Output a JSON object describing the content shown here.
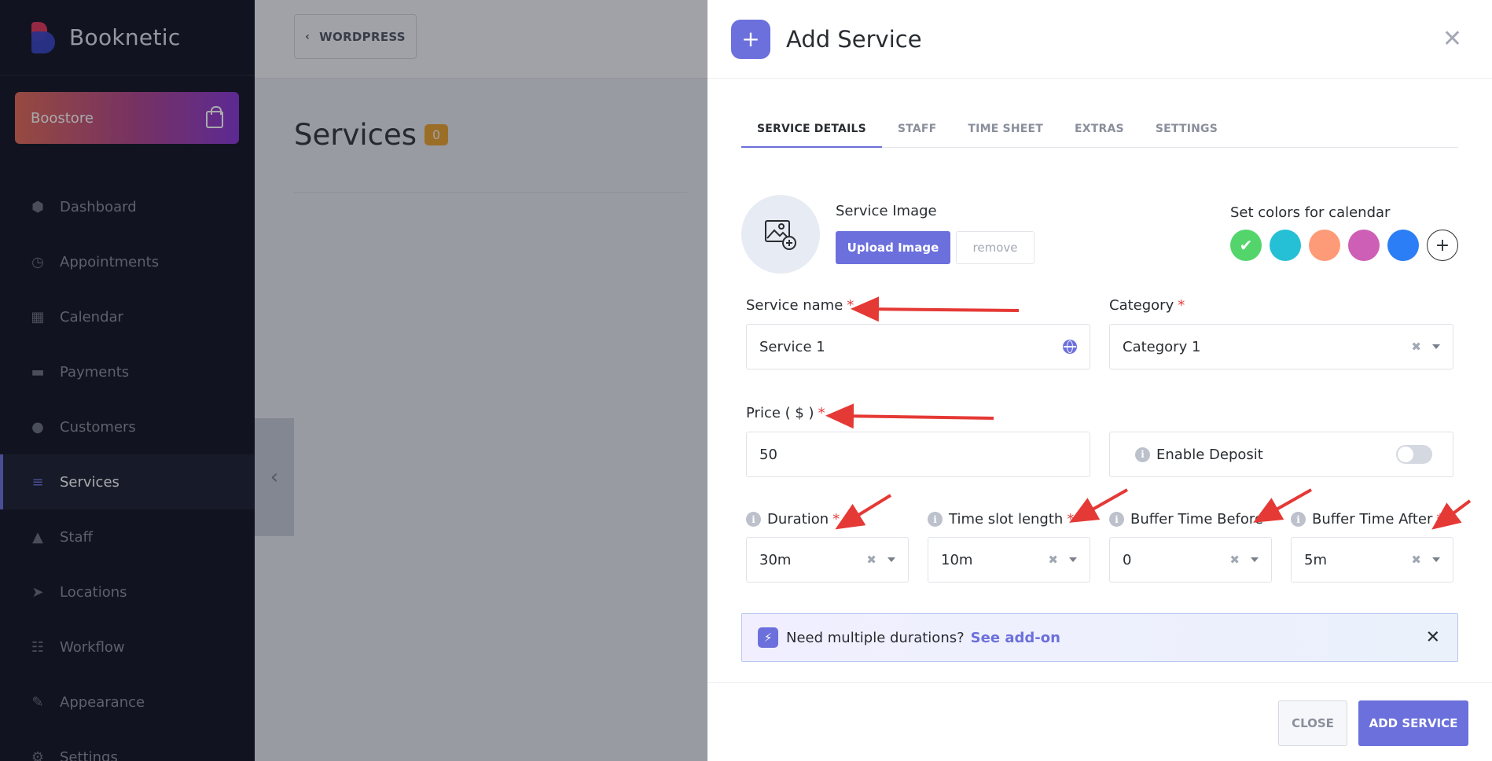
{
  "sidebar": {
    "app_name": "Booknetic",
    "boostore_label": "Boostore",
    "items": [
      {
        "label": "Dashboard",
        "icon": "cube-icon"
      },
      {
        "label": "Appointments",
        "icon": "clock-icon"
      },
      {
        "label": "Calendar",
        "icon": "calendar-icon"
      },
      {
        "label": "Payments",
        "icon": "wallet-icon"
      },
      {
        "label": "Customers",
        "icon": "users-icon"
      },
      {
        "label": "Services",
        "icon": "list-icon",
        "active": true
      },
      {
        "label": "Staff",
        "icon": "user-icon"
      },
      {
        "label": "Locations",
        "icon": "location-arrow-icon"
      },
      {
        "label": "Workflow",
        "icon": "workflow-icon"
      },
      {
        "label": "Appearance",
        "icon": "brush-icon"
      },
      {
        "label": "Settings",
        "icon": "gear-icon"
      }
    ]
  },
  "main": {
    "back_label": "WORDPRESS",
    "page_title": "Services",
    "count": "0"
  },
  "modal": {
    "title": "Add Service",
    "tabs": [
      "SERVICE DETAILS",
      "STAFF",
      "TIME SHEET",
      "EXTRAS",
      "SETTINGS"
    ],
    "service_image_label": "Service Image",
    "upload_label": "Upload Image",
    "remove_label": "remove",
    "colors_label": "Set colors for calendar",
    "colors": [
      "#53d56c",
      "#26c0d6",
      "#fd9b78",
      "#cd5fb6",
      "#2b7ef5"
    ],
    "service_name": {
      "label": "Service name",
      "value": "Service 1"
    },
    "category": {
      "label": "Category",
      "value": "Category 1"
    },
    "price": {
      "label": "Price ( $ )",
      "value": "50"
    },
    "deposit_label": "Enable Deposit",
    "duration": {
      "label": "Duration",
      "value": "30m"
    },
    "time_slot": {
      "label": "Time slot length",
      "value": "10m"
    },
    "buffer_before": {
      "label": "Buffer Time Before",
      "value": "0"
    },
    "buffer_after": {
      "label": "Buffer Time After",
      "value": "5m"
    },
    "addon_text": "Need multiple durations?",
    "addon_link": "See add-on",
    "close_label": "CLOSE",
    "add_label": "ADD SERVICE"
  },
  "colors": {
    "accent": "#6c70dc",
    "required": "#e53e3e",
    "annotation_arrow": "#e53935"
  }
}
